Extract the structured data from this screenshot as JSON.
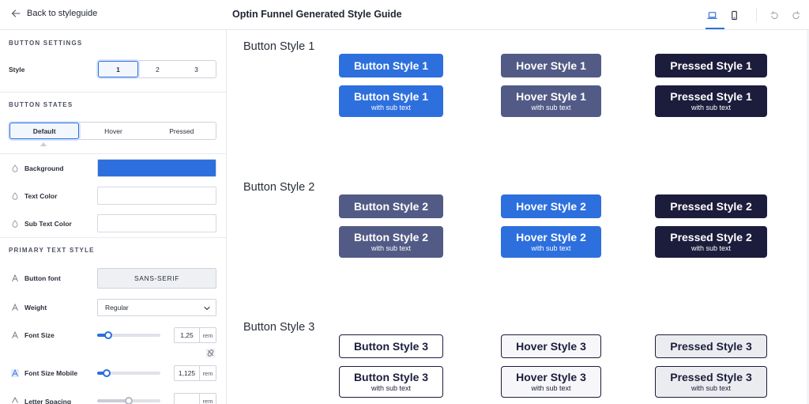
{
  "header": {
    "back_label": "Back to styleguide",
    "title": "Optin Funnel Generated Style Guide",
    "devices": [
      "laptop-icon",
      "mobile-icon"
    ],
    "actions": [
      "undo-icon",
      "redo-icon"
    ]
  },
  "sidebar": {
    "button_settings": {
      "title": "BUTTON SETTINGS",
      "style_label": "Style",
      "options": [
        "1",
        "2",
        "3"
      ],
      "selected": "1"
    },
    "button_states": {
      "title": "BUTTON STATES",
      "tabs": [
        "Default",
        "Hover",
        "Pressed"
      ],
      "selected": "Default"
    },
    "colors": {
      "background_label": "Background",
      "background_value": "#2d6fdd",
      "text_color_label": "Text Color",
      "text_color_value": "#ffffff",
      "sub_text_color_label": "Sub Text Color",
      "sub_text_color_value": "#ffffff"
    },
    "primary_text": {
      "title": "PRIMARY TEXT STYLE",
      "font_label": "Button font",
      "font_value": "SANS-SERIF",
      "weight_label": "Weight",
      "weight_value": "Regular",
      "font_size_label": "Font Size",
      "font_size_value": "1,25",
      "font_size_unit": "rem",
      "font_size_mobile_label": "Font Size Mobile",
      "font_size_mobile_value": "1,125",
      "font_size_mobile_unit": "rem",
      "letter_spacing_label": "Letter Spacing",
      "letter_spacing_unit": "rem"
    }
  },
  "preview": {
    "sections": [
      {
        "label": "Button Style 1",
        "buttons": [
          {
            "text": "Button Style 1",
            "variant": "default"
          },
          {
            "text": "Hover Style 1",
            "variant": "hover"
          },
          {
            "text": "Pressed Style 1",
            "variant": "pressed"
          },
          {
            "text": "Button Style 1",
            "sub": "with sub text",
            "variant": "default"
          },
          {
            "text": "Hover Style 1",
            "sub": "with sub text",
            "variant": "hover"
          },
          {
            "text": "Pressed Style 1",
            "sub": "with sub text",
            "variant": "pressed"
          }
        ]
      },
      {
        "label": "Button Style 2",
        "buttons": [
          {
            "text": "Button Style 2",
            "variant": "default"
          },
          {
            "text": "Hover Style 2",
            "variant": "hover"
          },
          {
            "text": "Pressed Style 2",
            "variant": "pressed"
          },
          {
            "text": "Button Style 2",
            "sub": "with sub text",
            "variant": "default"
          },
          {
            "text": "Hover Style 2",
            "sub": "with sub text",
            "variant": "hover"
          },
          {
            "text": "Pressed Style 2",
            "sub": "with sub text",
            "variant": "pressed"
          }
        ]
      },
      {
        "label": "Button Style 3",
        "buttons": [
          {
            "text": "Button Style 3",
            "variant": "default"
          },
          {
            "text": "Hover Style 3",
            "variant": "hover"
          },
          {
            "text": "Pressed Style 3",
            "variant": "pressed"
          },
          {
            "text": "Button Style 3",
            "sub": "with sub text",
            "variant": "default"
          },
          {
            "text": "Hover Style 3",
            "sub": "with sub text",
            "variant": "hover"
          },
          {
            "text": "Pressed Style 3",
            "sub": "with sub text",
            "variant": "pressed"
          }
        ]
      }
    ],
    "colors": {
      "blue": "#2d6fdd",
      "slate": "#525b86",
      "navy": "#1c1d3c",
      "outline_bg": "#ffffff",
      "outline_hover_bg": "#f7f7f9",
      "outline_pressed_bg": "#ebecef",
      "outline_text": "#1c1d3c",
      "accent": "#2b6fde"
    }
  }
}
